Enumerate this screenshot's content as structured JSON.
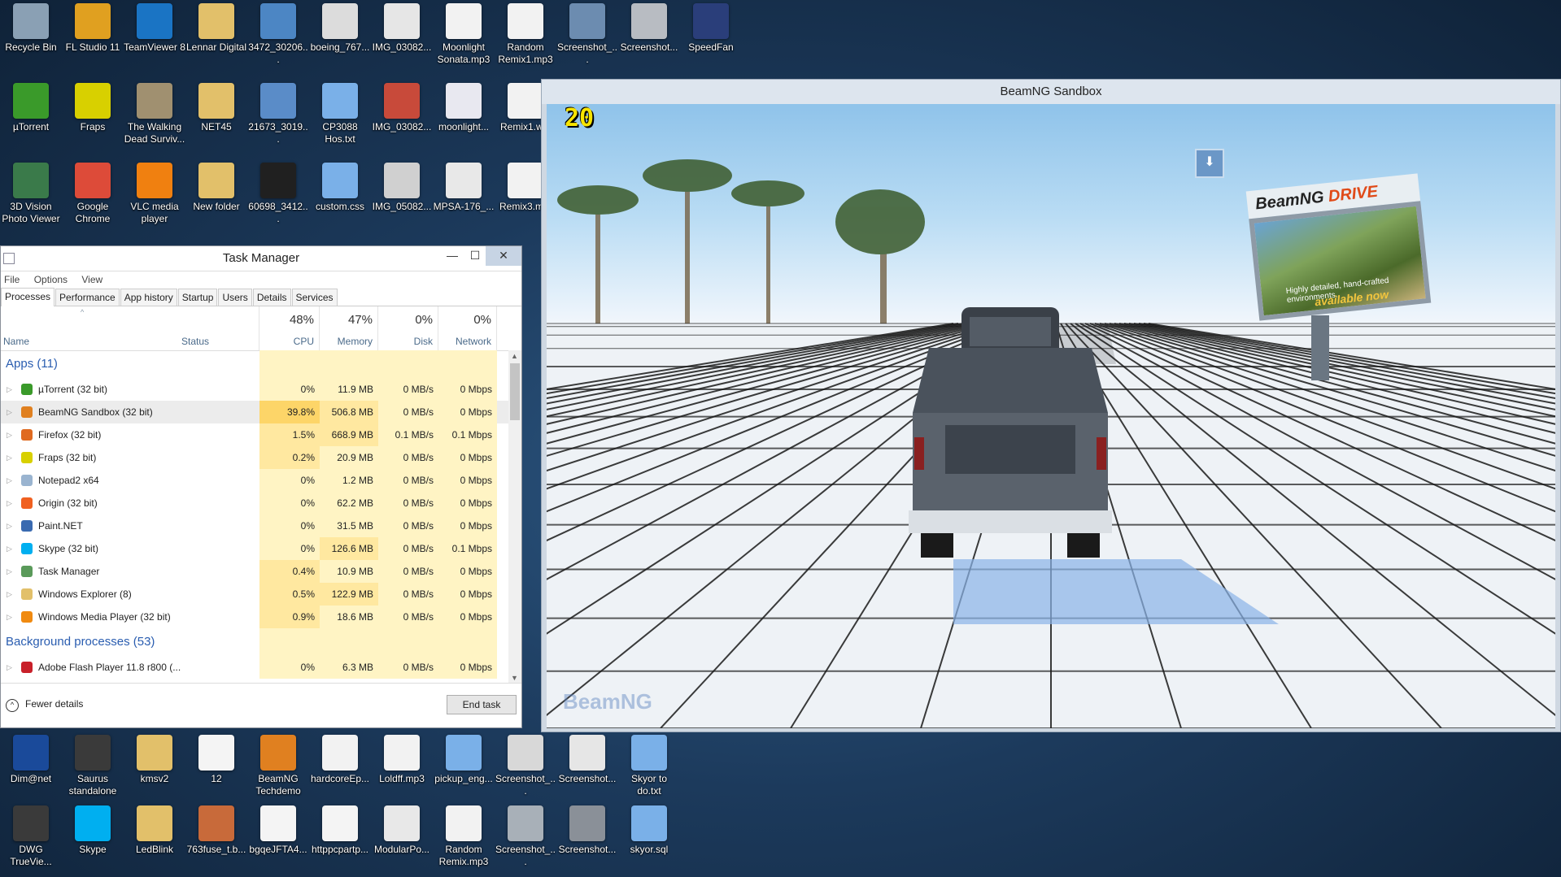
{
  "desktop": {
    "icons_top": [
      {
        "label": "Recycle Bin",
        "icon": "recycle-bin-icon",
        "color": "#8aa0b4"
      },
      {
        "label": "FL Studio 11",
        "icon": "fl-studio-icon",
        "color": "#e0a020"
      },
      {
        "label": "TeamViewer 8",
        "icon": "teamviewer-icon",
        "color": "#1a74c4"
      },
      {
        "label": "Lennar Digital",
        "icon": "folder-icon",
        "color": "#e2c06a"
      },
      {
        "label": "3472_30206...",
        "icon": "image-icon",
        "color": "#4c86c4"
      },
      {
        "label": "boeing_767...",
        "icon": "image-icon",
        "color": "#dcdcdc"
      },
      {
        "label": "IMG_03082...",
        "icon": "image-icon",
        "color": "#e6e6e6"
      },
      {
        "label": "Moonlight Sonata.mp3",
        "icon": "mp3-icon",
        "color": "#f2f2f2"
      },
      {
        "label": "Random Remix1.mp3",
        "icon": "mp3-icon",
        "color": "#f2f2f2"
      },
      {
        "label": "Screenshot_...",
        "icon": "image-icon",
        "color": "#6c8cb0"
      },
      {
        "label": "Screenshot...",
        "icon": "image-icon",
        "color": "#b8bcc2"
      },
      {
        "label": "SpeedFan",
        "icon": "speedfan-icon",
        "color": "#2a3e7a"
      },
      {
        "label": "µTorrent",
        "icon": "utorrent-icon",
        "color": "#3a9a2a"
      },
      {
        "label": "Fraps",
        "icon": "fraps-icon",
        "color": "#d8d000"
      },
      {
        "label": "The Walking Dead Surviv...",
        "icon": "game-icon",
        "color": "#a09070"
      },
      {
        "label": "NET45",
        "icon": "folder-icon",
        "color": "#e2c06a"
      },
      {
        "label": "21673_3019...",
        "icon": "image-icon",
        "color": "#5a8cc8"
      },
      {
        "label": "CP3088 Hos.txt",
        "icon": "text-file-icon",
        "color": "#7ab0e8"
      },
      {
        "label": "IMG_03082...",
        "icon": "image-icon",
        "color": "#c84a3a"
      },
      {
        "label": "moonlight...",
        "icon": "audio-icon",
        "color": "#e8e8f0"
      },
      {
        "label": "Remix1.w...",
        "icon": "wav-icon",
        "color": "#f2f2f2"
      },
      {
        "label": "3D Vision Photo Viewer",
        "icon": "3d-vision-icon",
        "color": "#3a7a4a"
      },
      {
        "label": "Google Chrome",
        "icon": "chrome-icon",
        "color": "#dd4b39"
      },
      {
        "label": "VLC media player",
        "icon": "vlc-icon",
        "color": "#f08010"
      },
      {
        "label": "New folder",
        "icon": "folder-icon",
        "color": "#e2c06a"
      },
      {
        "label": "60698_3412...",
        "icon": "image-icon",
        "color": "#202020"
      },
      {
        "label": "custom.css",
        "icon": "text-file-icon",
        "color": "#7ab0e8"
      },
      {
        "label": "IMG_05082...",
        "icon": "image-icon",
        "color": "#d0d0d0"
      },
      {
        "label": "MPSA-176_...",
        "icon": "java-icon",
        "color": "#e8e8e8"
      },
      {
        "label": "Remix3.m...",
        "icon": "mp3-icon",
        "color": "#f2f2f2"
      }
    ],
    "icons_bottom": [
      {
        "label": "Dim@net",
        "icon": "3g-net-icon",
        "color": "#1a4a9a"
      },
      {
        "label": "Saurus standalone",
        "icon": "saurus-icon",
        "color": "#3a3a3a"
      },
      {
        "label": "kmsv2",
        "icon": "folder-icon",
        "color": "#e2c06a"
      },
      {
        "label": "12",
        "icon": "file-icon",
        "color": "#f4f4f4"
      },
      {
        "label": "BeamNG Techdemo",
        "icon": "beamng-icon",
        "color": "#e08020"
      },
      {
        "label": "hardcoreEp...",
        "icon": "mp3-icon",
        "color": "#f2f2f2"
      },
      {
        "label": "Loldff.mp3",
        "icon": "mp3-icon",
        "color": "#f2f2f2"
      },
      {
        "label": "pickup_eng...",
        "icon": "text-file-icon",
        "color": "#7ab0e8"
      },
      {
        "label": "Screenshot_...",
        "icon": "image-icon",
        "color": "#d8d8d8"
      },
      {
        "label": "Screenshot...",
        "icon": "image-icon",
        "color": "#e6e6e6"
      },
      {
        "label": "Skyor to do.txt",
        "icon": "text-file-icon",
        "color": "#7ab0e8"
      },
      {
        "label": "DWG TrueVie...",
        "icon": "dwg-icon",
        "color": "#3a3a3a"
      },
      {
        "label": "Skype",
        "icon": "skype-icon",
        "color": "#00aff0"
      },
      {
        "label": "LedBlink",
        "icon": "folder-icon",
        "color": "#e2c06a"
      },
      {
        "label": "763fuse_t.b...",
        "icon": "image-icon",
        "color": "#c86a3a"
      },
      {
        "label": "bgqeJFTA4...",
        "icon": "file-icon",
        "color": "#f4f4f4"
      },
      {
        "label": "httppcpartp...",
        "icon": "file-icon",
        "color": "#f4f4f4"
      },
      {
        "label": "ModularPo...",
        "icon": "java-icon",
        "color": "#e8e8e8"
      },
      {
        "label": "Random Remix.mp3",
        "icon": "mp3-icon",
        "color": "#f2f2f2"
      },
      {
        "label": "Screenshot_...",
        "icon": "image-icon",
        "color": "#a8b0b8"
      },
      {
        "label": "Screenshot...",
        "icon": "image-icon",
        "color": "#8a9098"
      },
      {
        "label": "skyor.sql",
        "icon": "text-file-icon",
        "color": "#7ab0e8"
      }
    ]
  },
  "beamng": {
    "title": "BeamNG Sandbox",
    "fps": "20",
    "logo": "BeamNG",
    "billboard_brand": "BeamNG",
    "billboard_product": "DRIVE",
    "billboard_caption": "Highly detailed, hand-crafted environments.",
    "billboard_avail": "available now"
  },
  "task_manager": {
    "title": "Task Manager",
    "menu": [
      "File",
      "Options",
      "View"
    ],
    "tabs": [
      "Processes",
      "Performance",
      "App history",
      "Startup",
      "Users",
      "Details",
      "Services"
    ],
    "active_tab": "Processes",
    "headers": {
      "name": "Name",
      "status": "Status",
      "cpu_pct": "48%",
      "cpu_lbl": "CPU",
      "mem_pct": "47%",
      "mem_lbl": "Memory",
      "disk_pct": "0%",
      "disk_lbl": "Disk",
      "net_pct": "0%",
      "net_lbl": "Network"
    },
    "apps_group": "Apps (11)",
    "apps": [
      {
        "name": "µTorrent (32 bit)",
        "icon": "utorrent-icon",
        "color": "#3a9a2a",
        "cpu": "0%",
        "mem": "11.9 MB",
        "disk": "0 MB/s",
        "net": "0 Mbps"
      },
      {
        "name": "BeamNG Sandbox (32 bit)",
        "icon": "beamng-icon",
        "color": "#e08020",
        "cpu": "39.8%",
        "mem": "506.8 MB",
        "disk": "0 MB/s",
        "net": "0 Mbps"
      },
      {
        "name": "Firefox (32 bit)",
        "icon": "firefox-icon",
        "color": "#e06a20",
        "cpu": "1.5%",
        "mem": "668.9 MB",
        "disk": "0.1 MB/s",
        "net": "0.1 Mbps"
      },
      {
        "name": "Fraps (32 bit)",
        "icon": "fraps-icon",
        "color": "#d8d000",
        "cpu": "0.2%",
        "mem": "20.9 MB",
        "disk": "0 MB/s",
        "net": "0 Mbps"
      },
      {
        "name": "Notepad2 x64",
        "icon": "notepad-icon",
        "color": "#9ab4d0",
        "cpu": "0%",
        "mem": "1.2 MB",
        "disk": "0 MB/s",
        "net": "0 Mbps"
      },
      {
        "name": "Origin (32 bit)",
        "icon": "origin-icon",
        "color": "#f06020",
        "cpu": "0%",
        "mem": "62.2 MB",
        "disk": "0 MB/s",
        "net": "0 Mbps"
      },
      {
        "name": "Paint.NET",
        "icon": "paintnet-icon",
        "color": "#3a6ab0",
        "cpu": "0%",
        "mem": "31.5 MB",
        "disk": "0 MB/s",
        "net": "0 Mbps"
      },
      {
        "name": "Skype (32 bit)",
        "icon": "skype-icon",
        "color": "#00aff0",
        "cpu": "0%",
        "mem": "126.6 MB",
        "disk": "0 MB/s",
        "net": "0.1 Mbps"
      },
      {
        "name": "Task Manager",
        "icon": "task-manager-icon",
        "color": "#5a9a5a",
        "cpu": "0.4%",
        "mem": "10.9 MB",
        "disk": "0 MB/s",
        "net": "0 Mbps"
      },
      {
        "name": "Windows Explorer (8)",
        "icon": "explorer-icon",
        "color": "#e2c06a",
        "cpu": "0.5%",
        "mem": "122.9 MB",
        "disk": "0 MB/s",
        "net": "0 Mbps"
      },
      {
        "name": "Windows Media Player (32 bit)",
        "icon": "media-player-icon",
        "color": "#f08a10",
        "cpu": "0.9%",
        "mem": "18.6 MB",
        "disk": "0 MB/s",
        "net": "0 Mbps"
      }
    ],
    "bg_group": "Background processes (53)",
    "bg": [
      {
        "name": "Adobe Flash Player 11.8 r800 (...",
        "icon": "flash-icon",
        "color": "#c8202a",
        "cpu": "0%",
        "mem": "6.3 MB",
        "disk": "0 MB/s",
        "net": "0 Mbps"
      }
    ],
    "fewer_details": "Fewer details",
    "end_task": "End task"
  }
}
